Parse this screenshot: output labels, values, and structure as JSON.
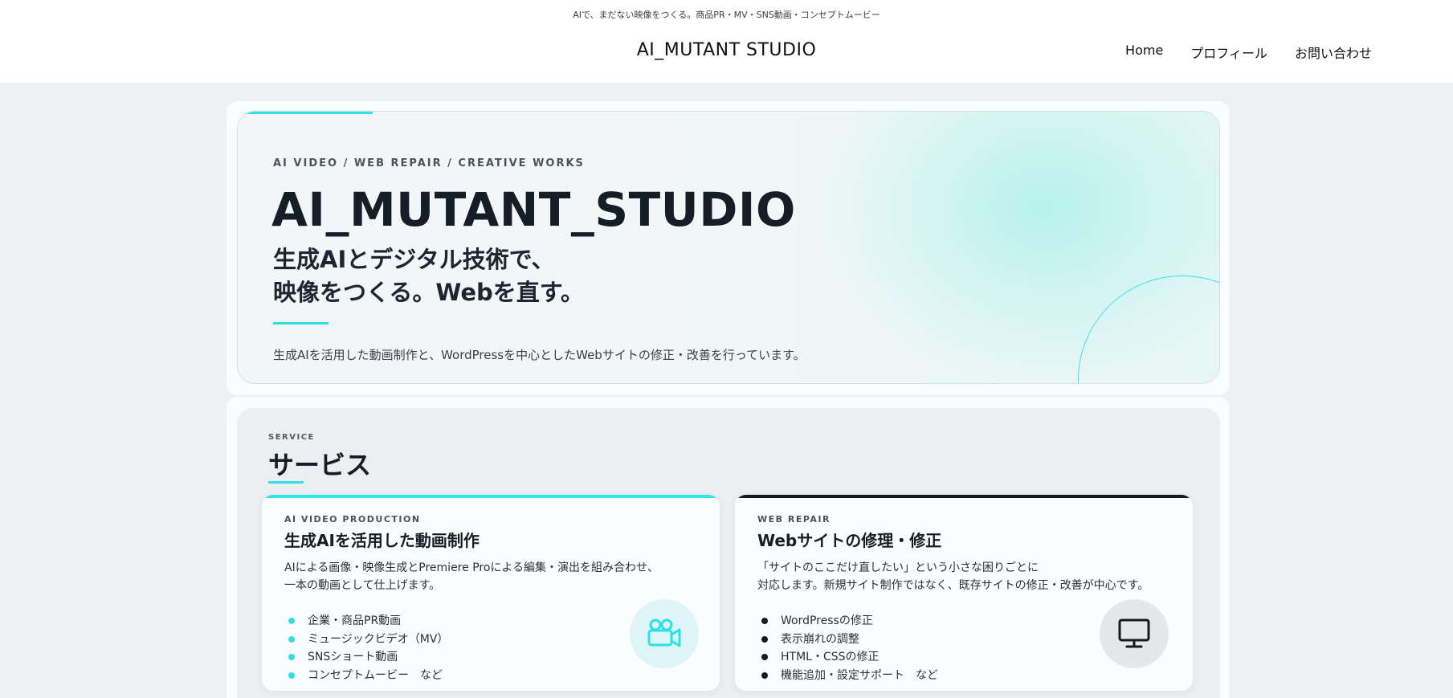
{
  "header": {
    "tagline": "AIで、まだない映像をつくる。商品PR・MV・SNS動画・コンセプトムービー",
    "site_title": "AI_MUTANT STUDIO",
    "nav": [
      {
        "label": "Home"
      },
      {
        "label": "プロフィール"
      },
      {
        "label": "お問い合わせ"
      }
    ]
  },
  "hero": {
    "eyebrow": "AI VIDEO / WEB REPAIR / CREATIVE WORKS",
    "title": "AI_MUTANT_STUDIO",
    "subtitle_line1": "生成AIとデジタル技術で、",
    "subtitle_line2": "映像をつくる。Webを直す。",
    "description": "生成AIを活用した動画制作と、WordPressを中心としたWebサイトの修正・改善を行っています。"
  },
  "service": {
    "eyebrow": "SERVICE",
    "title": "サービス",
    "cards": [
      {
        "eyebrow": "AI VIDEO PRODUCTION",
        "title": "生成AIを活用した動画制作",
        "desc_line1": "AIによる画像・映像生成とPremiere Proによる編集・演出を組み合わせ、",
        "desc_line2": "一本の動画として仕上げます。",
        "items": [
          "企業・商品PR動画",
          "ミュージックビデオ（MV）",
          "SNSショート動画",
          "コンセプトムービー　など"
        ],
        "icon": "video-camera-icon"
      },
      {
        "eyebrow": "WEB REPAIR",
        "title": "Webサイトの修理・修正",
        "desc_line1": "「サイトのここだけ直したい」という小さな困りごとに",
        "desc_line2": "対応します。新規サイト制作ではなく、既存サイトの修正・改善が中心です。",
        "items": [
          "WordPressの修正",
          "表示崩れの調整",
          "HTML・CSSの修正",
          "機能追加・設定サポート　など"
        ],
        "icon": "monitor-icon"
      }
    ]
  },
  "colors": {
    "accent": "#2ee0e6",
    "dark": "#16191d",
    "background": "#eef1f3"
  }
}
